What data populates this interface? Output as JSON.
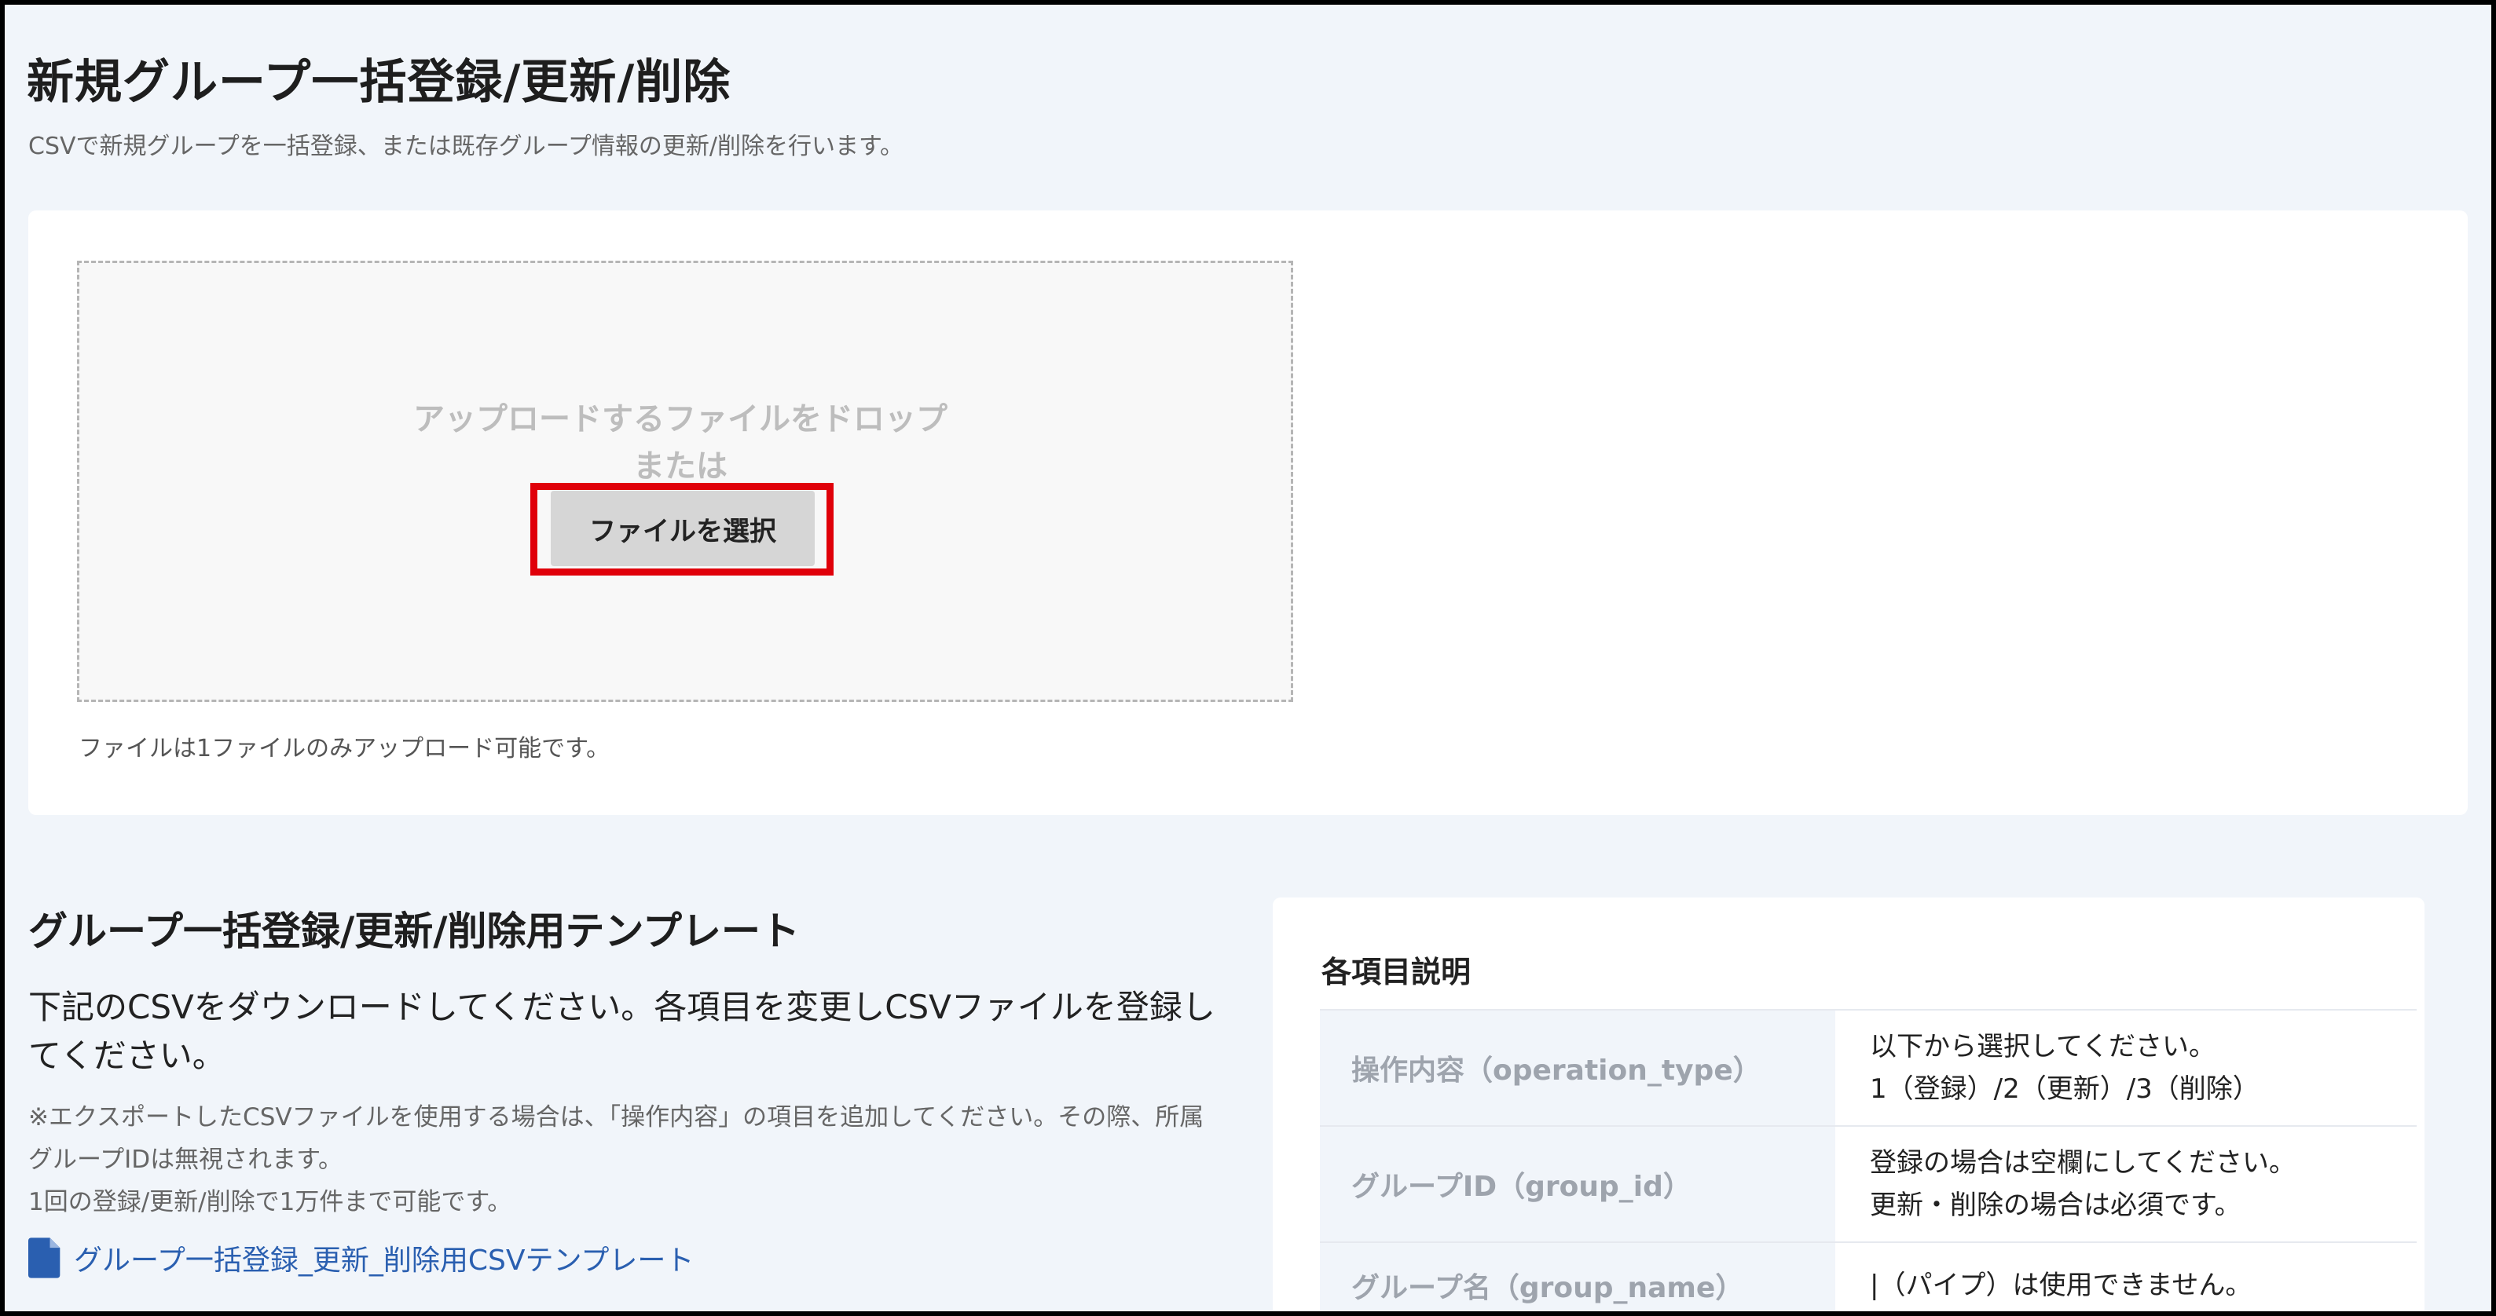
{
  "header": {
    "title": "新規グループ一括登録/更新/削除",
    "subtitle": "CSVで新規グループを一括登録、または既存グループ情報の更新/削除を行います。"
  },
  "upload": {
    "drop_text": "アップロードするファイルをドロップ",
    "or_text": "または",
    "select_button": "ファイルを選択",
    "note": "ファイルは1ファイルのみアップロード可能です。"
  },
  "template": {
    "title": "グループ一括登録/更新/削除用テンプレート",
    "description": "下記のCSVをダウンロードしてください。各項目を変更しCSVファイルを登録してください。",
    "note_1": "※エクスポートしたCSVファイルを使用する場合は、「操作内容」の項目を追加してください。その際、所属グループIDは無視されます。",
    "note_2": "1回の登録/更新/削除で1万件まで可能です。",
    "link": "グループ一括登録_更新_削除用CSVテンプレート",
    "link_icon": "document-icon"
  },
  "spec": {
    "title": "各項目説明",
    "rows": [
      {
        "key": "操作内容（operation_type）",
        "lines": [
          "以下から選択してください。",
          "1（登録）/2（更新）/3（削除）"
        ]
      },
      {
        "key": "グループID（group_id）",
        "lines": [
          "登録の場合は空欄にしてください。",
          "更新・削除の場合は必須です。"
        ]
      },
      {
        "key": "グループ名（group_name）",
        "lines": [
          "|（パイプ）は使用できません。"
        ]
      }
    ]
  },
  "colors": {
    "highlight": "#e0000a",
    "link": "#2a5fb0"
  }
}
